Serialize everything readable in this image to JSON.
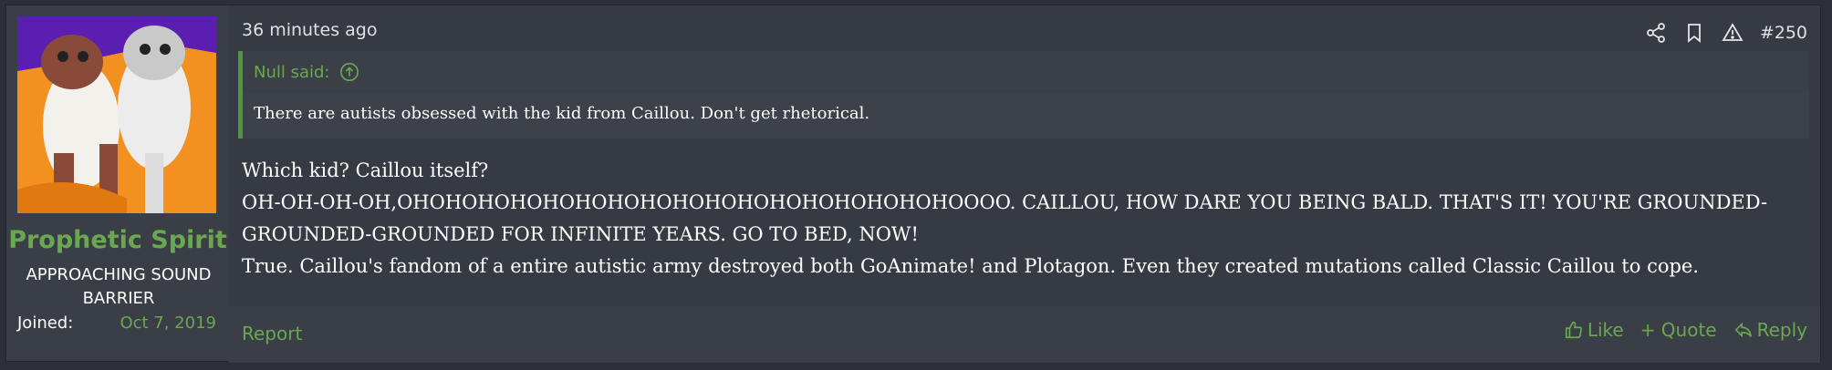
{
  "user": {
    "name": "Prophetic Spirit",
    "title": "APPROACHING SOUND BARRIER",
    "joined_label": "Joined:",
    "joined_value": "Oct 7, 2019"
  },
  "post": {
    "time": "36 minutes ago",
    "number": "#250",
    "quote": {
      "author_line": "Null said:",
      "text": "There are autists obsessed with the kid from Caillou. Don't get rhetorical."
    },
    "body": {
      "line1": "Which kid? Caillou itself?",
      "line2": "OH-OH-OH-OH,OHOHOHOHOHOHOHOHOHOHOHOHOHOHOHOHOHOOOO. CAILLOU, HOW DARE YOU BEING BALD. THAT'S IT! YOU'RE GROUNDED-GROUNDED-GROUNDED FOR INFINITE YEARS. GO TO BED, NOW!",
      "line3": "True. Caillou's fandom of a entire autistic army destroyed both GoAnimate! and Plotagon. Even they created mutations called Classic Caillou to cope."
    }
  },
  "footer": {
    "report": "Report",
    "like": "Like",
    "quote": "+ Quote",
    "reply": "Reply"
  },
  "icons": {
    "share": "share-icon",
    "bookmark": "bookmark-icon",
    "warning": "warning-icon",
    "up_arrow": "arrow-up-circle-icon",
    "like": "thumbs-up-icon",
    "reply": "reply-icon"
  },
  "colors": {
    "accent": "#6aa84f",
    "quote_border": "#4a9a3a",
    "post_bg": "#353a43"
  }
}
